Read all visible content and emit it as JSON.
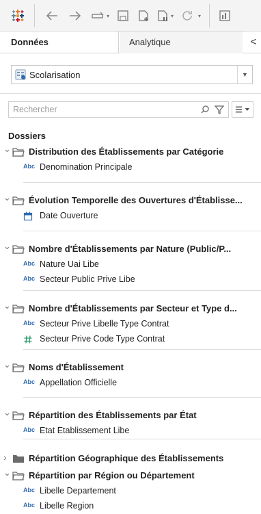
{
  "toolbar": {
    "icons": [
      "tableau-logo-icon",
      "back-arrow-icon",
      "forward-arrow-icon",
      "redo-replay-icon",
      "save-icon",
      "new-datasource-icon",
      "pause-updates-icon",
      "refresh-icon",
      "show-me-icon"
    ]
  },
  "tabs": {
    "data": "Données",
    "analytics": "Analytique",
    "collapse": "<"
  },
  "datasource": {
    "label": "Scolarisation"
  },
  "search": {
    "placeholder": "Rechercher"
  },
  "dossiers_heading": "Dossiers",
  "folders": [
    {
      "label": "Distribution des Établissements par Catégorie",
      "expanded": true,
      "fields": [
        {
          "type": "Abc",
          "label": "Denomination Principale"
        }
      ]
    },
    {
      "label": "Évolution Temporelle des Ouvertures d'Établisse...",
      "expanded": true,
      "fields": [
        {
          "type": "date",
          "label": "Date Ouverture"
        }
      ]
    },
    {
      "label": "Nombre d'Établissements par Nature (Public/P...",
      "expanded": true,
      "fields": [
        {
          "type": "Abc",
          "label": "Nature Uai Libe"
        },
        {
          "type": "Abc",
          "label": "Secteur Public Prive Libe"
        }
      ]
    },
    {
      "label": "Nombre d'Établissements par Secteur et Type d...",
      "expanded": true,
      "fields": [
        {
          "type": "Abc",
          "label": "Secteur Prive Libelle Type Contrat"
        },
        {
          "type": "#",
          "label": "Secteur Prive Code Type Contrat"
        }
      ]
    },
    {
      "label": "Noms d'Établissement",
      "expanded": true,
      "fields": [
        {
          "type": "Abc",
          "label": "Appellation Officielle"
        }
      ]
    },
    {
      "label": "Répartition des Établissements par État",
      "expanded": true,
      "fields": [
        {
          "type": "Abc",
          "label": "Etat Etablissement Libe"
        }
      ]
    },
    {
      "label": "Répartition Géographique des Établissements",
      "expanded": false,
      "fields": []
    },
    {
      "label": "Répartition par Région ou Département",
      "expanded": true,
      "fields": [
        {
          "type": "Abc",
          "label": "Libelle Departement"
        },
        {
          "type": "Abc",
          "label": "Libelle Region"
        }
      ]
    }
  ],
  "colors": {
    "abc": "#2f6ab0",
    "date": "#2f6ab0",
    "number": "#2a9d6e",
    "folder": "#6b6b6b"
  }
}
